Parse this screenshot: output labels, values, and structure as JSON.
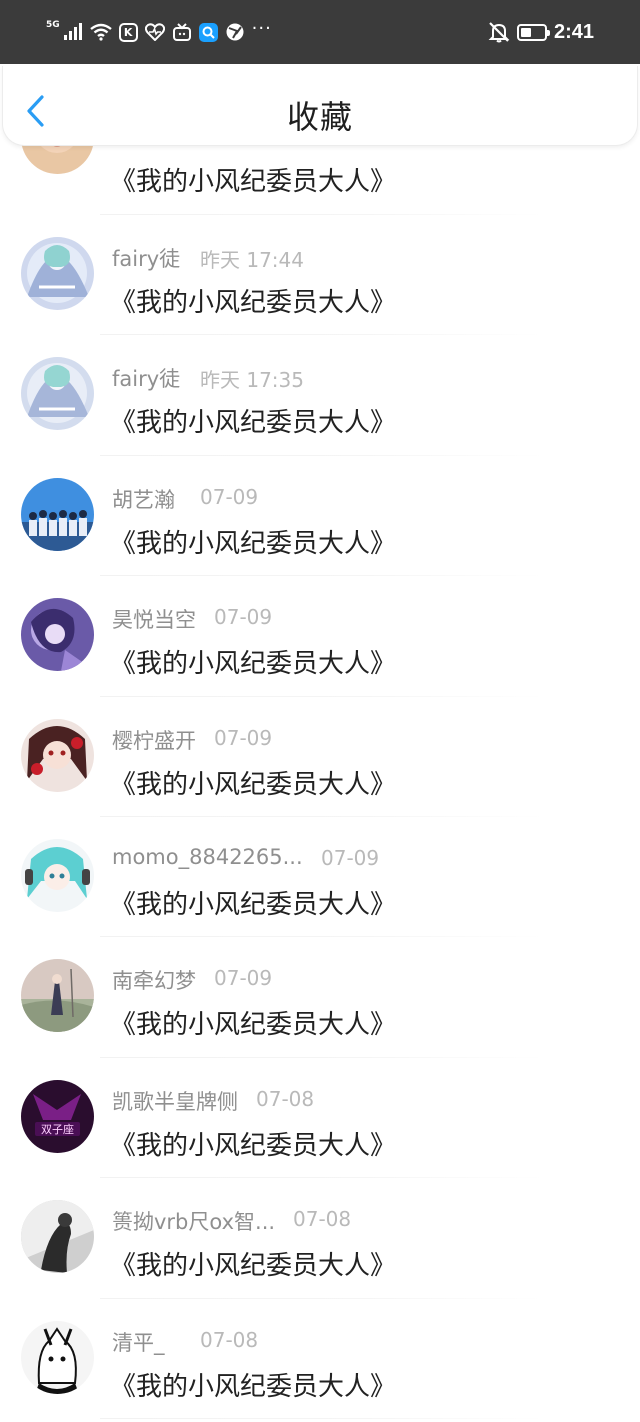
{
  "status_bar": {
    "network": "5G",
    "time": "2:41",
    "more": "···",
    "battery_level": 0.45
  },
  "header": {
    "title": "收藏"
  },
  "favorites": [
    {
      "user": "",
      "time": "",
      "title": "《我的小风纪委员大人》"
    },
    {
      "user": "fairy徒",
      "time": "昨天 17:44",
      "title": "《我的小风纪委员大人》"
    },
    {
      "user": "fairy徒",
      "time": "昨天 17:35",
      "title": "《我的小风纪委员大人》"
    },
    {
      "user": "胡艺瀚",
      "time": "07-09",
      "title": "《我的小风纪委员大人》"
    },
    {
      "user": "昊悦当空",
      "time": "07-09",
      "title": "《我的小风纪委员大人》"
    },
    {
      "user": "樱柠盛开",
      "time": "07-09",
      "title": "《我的小风纪委员大人》"
    },
    {
      "user": "momo_8842265...",
      "time": "07-09",
      "title": "《我的小风纪委员大人》"
    },
    {
      "user": "南牵幻梦",
      "time": "07-09",
      "title": "《我的小风纪委员大人》"
    },
    {
      "user": "凯歌半皇牌侧",
      "time": "07-08",
      "title": "《我的小风纪委员大人》"
    },
    {
      "user": "篑拗vrb尺ox智...",
      "time": "07-08",
      "title": "《我的小风纪委员大人》"
    },
    {
      "user": "清平_",
      "time": "07-08",
      "title": "《我的小风纪委员大人》"
    }
  ],
  "colors": {
    "accent": "#2a9df4",
    "status_bar_bg": "#3b3b3b",
    "username": "#8f8f8f",
    "time": "#b9b9b9",
    "title": "#222222"
  }
}
